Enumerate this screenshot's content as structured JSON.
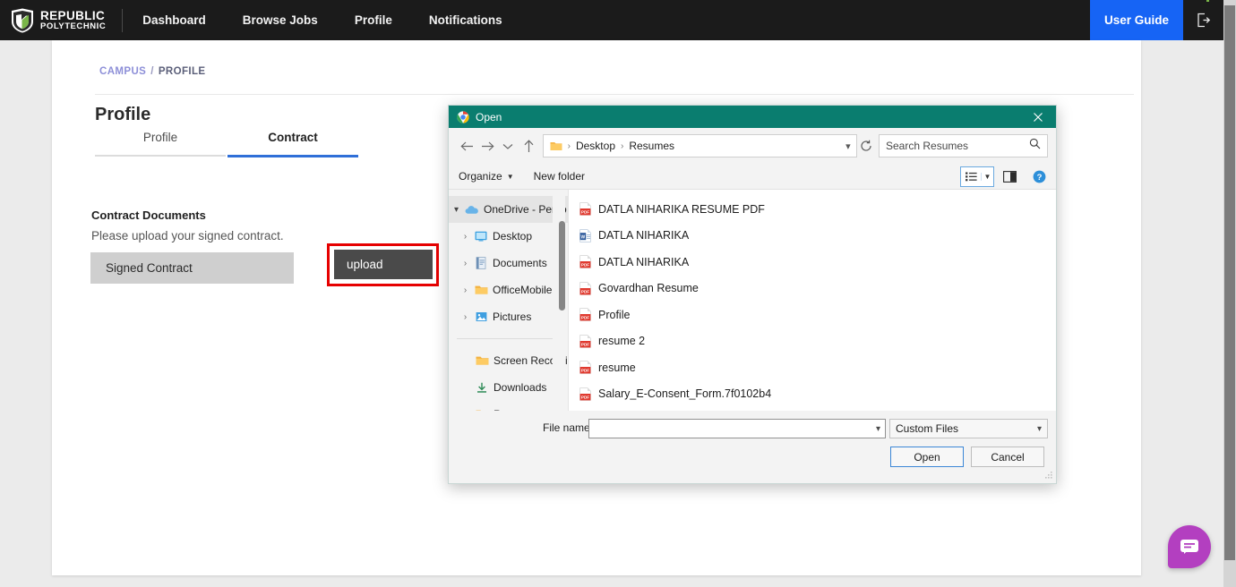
{
  "topnav": {
    "logo": {
      "line1": "REPUBLIC",
      "line2": "POLYTECHNIC",
      "icon": "shield-icon"
    },
    "items": [
      {
        "label": "Dashboard"
      },
      {
        "label": "Browse Jobs"
      },
      {
        "label": "Profile"
      },
      {
        "label": "Notifications"
      }
    ],
    "user_guide_label": "User Guide",
    "logout_icon": "logout-icon",
    "accent_blue": "#1664f5",
    "background": "#1b1b1b"
  },
  "page": {
    "breadcrumb": {
      "root": "CAMPUS",
      "separator": "/",
      "current": "PROFILE"
    },
    "title": "Profile",
    "tabs": [
      {
        "label": "Profile",
        "active": false
      },
      {
        "label": "Contract",
        "active": true
      }
    ],
    "active_tab_color": "#2f6fd8",
    "section": {
      "heading": "Contract Documents",
      "subtext": "Please upload your signed contract.",
      "document_label": "Signed Contract",
      "upload_button": "upload",
      "highlight_color": "#e60000"
    },
    "chat_fab": {
      "icon": "chat-bubble-icon",
      "color": "#b33fc0"
    }
  },
  "dialog": {
    "title": "Open",
    "title_icon": "chrome-icon",
    "title_bar_color": "#0a7d6f",
    "close_icon": "close-icon",
    "nav": {
      "back_icon": "arrow-left-icon",
      "forward_icon": "arrow-right-icon",
      "recent_icon": "chevron-down-icon",
      "up_icon": "arrow-up-icon",
      "address_folder_icon": "folder-icon",
      "breadcrumbs": [
        "Desktop",
        "Resumes"
      ],
      "address_chevron_icon": "chevron-down-icon",
      "refresh_icon": "refresh-icon",
      "search_placeholder": "Search Resumes",
      "search_value": "",
      "search_icon": "search-icon"
    },
    "toolbar": {
      "organize": "Organize",
      "organize_caret_icon": "caret-down-icon",
      "new_folder": "New folder",
      "view_icon": "list-view-icon",
      "view_caret_icon": "caret-down-icon",
      "preview_pane_icon": "preview-pane-icon",
      "help_icon": "help-icon"
    },
    "sidebar": [
      {
        "label": "OneDrive - Perso",
        "icon": "onedrive-icon",
        "expanded": true,
        "indent": false,
        "selected": true
      },
      {
        "label": "Desktop",
        "icon": "desktop-icon",
        "expanded": false,
        "indent": true,
        "selected": false
      },
      {
        "label": "Documents",
        "icon": "documents-icon",
        "expanded": false,
        "indent": true,
        "selected": false
      },
      {
        "label": "OfficeMobile",
        "icon": "folder-icon",
        "expanded": false,
        "indent": true,
        "selected": false
      },
      {
        "label": "Pictures",
        "icon": "pictures-icon",
        "expanded": false,
        "indent": true,
        "selected": false
      }
    ],
    "sidebar_bottom": [
      {
        "label": "Screen Recordin",
        "icon": "folder-icon"
      },
      {
        "label": "Downloads",
        "icon": "downloads-icon"
      },
      {
        "label": "Resumes",
        "icon": "folder-icon"
      }
    ],
    "files": [
      {
        "name": "DATLA NIHARIKA RESUME PDF",
        "icon": "pdf-icon"
      },
      {
        "name": "DATLA NIHARIKA",
        "icon": "word-icon"
      },
      {
        "name": "DATLA NIHARIKA",
        "icon": "pdf-icon"
      },
      {
        "name": "Govardhan Resume",
        "icon": "pdf-icon"
      },
      {
        "name": "Profile",
        "icon": "pdf-icon"
      },
      {
        "name": "resume 2",
        "icon": "pdf-icon"
      },
      {
        "name": "resume",
        "icon": "pdf-icon"
      },
      {
        "name": "Salary_E-Consent_Form.7f0102b4",
        "icon": "pdf-icon"
      }
    ],
    "footer": {
      "filename_label": "File name:",
      "filename_value": "",
      "filename_placeholder": "",
      "filetype_value": "Custom Files",
      "open_button": "Open",
      "cancel_button": "Cancel"
    }
  }
}
